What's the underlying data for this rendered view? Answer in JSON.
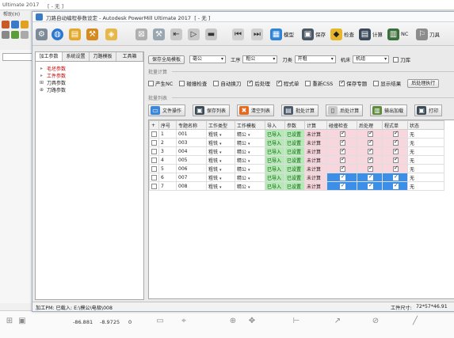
{
  "host": {
    "title": "Ultimate 2017",
    "title_tag": "[ - 无 ]",
    "menu_label": "帮助(H)",
    "status": {
      "coord_x": "-86.881",
      "coord_y": "-8.9725",
      "coord_z": "0",
      "icons": [
        "grid-snap-icon",
        "layer-icon",
        "plane-icon",
        "workplane-icon",
        "axis-icon",
        "view-icon",
        "measure-icon",
        "arrow-icon",
        "snap-icon"
      ]
    }
  },
  "window": {
    "title": "刀路自动编程参数设定 - Autodesk PowerMill Ultimate 2017",
    "title_suffix": "[ - 无 ]"
  },
  "toolbar": {
    "items": [
      {
        "icon": "gear-icon",
        "label": ""
      },
      {
        "icon": "globe-icon",
        "label": ""
      },
      {
        "icon": "toolpath-icon",
        "label": ""
      },
      {
        "icon": "machine-icon",
        "label": ""
      },
      {
        "icon": "block-icon",
        "label": ""
      },
      {
        "icon": "axis-icon",
        "label": ""
      },
      {
        "icon": "wrench-icon",
        "label": ""
      },
      {
        "icon": "arrow-left-icon",
        "label": ""
      },
      {
        "icon": "play-icon",
        "label": ""
      },
      {
        "icon": "panel-icon",
        "label": ""
      },
      {
        "icon": "first-icon",
        "label": ""
      },
      {
        "icon": "last-icon",
        "label": ""
      },
      {
        "icon": "model-icon",
        "label": "模型"
      },
      {
        "icon": "save-icon",
        "label": "保存"
      },
      {
        "icon": "warning-icon",
        "label": "检查"
      },
      {
        "icon": "calc-icon",
        "label": "计算"
      },
      {
        "icon": "nc-icon",
        "label": "NC"
      },
      {
        "icon": "tool-icon",
        "label": "刀具"
      }
    ]
  },
  "tree": {
    "tabs": [
      "加工参数",
      "系统设置",
      "刀路模板",
      "工具箱"
    ],
    "items": [
      {
        "icon": "triangle-icon",
        "label": "毛坯参数",
        "dark": false
      },
      {
        "icon": "triangle-icon",
        "label": "工件参数",
        "dark": false
      },
      {
        "icon": "tree-node-icon",
        "label": "刀具参数",
        "dark": true
      },
      {
        "icon": "tree-node-icon",
        "label": "刀路参数",
        "dark": true
      }
    ]
  },
  "options": {
    "template_button": "保存全局模板",
    "unit_value": "毫公",
    "process_label": "工序",
    "process_value": "粗公",
    "mode_label": "刀类",
    "mode_value": "开粗",
    "machine_label": "机床",
    "machine_value": "机组",
    "tool_checkbox": "刀库",
    "section_header": "批量计算",
    "checkboxes": [
      {
        "label": "产生NC",
        "checked": false
      },
      {
        "label": "碰撞检查",
        "checked": false
      },
      {
        "label": "自动换刀",
        "checked": false
      },
      {
        "label": "后处理",
        "checked": true
      },
      {
        "label": "程式单",
        "checked": true
      },
      {
        "label": "重新CSS",
        "checked": false
      },
      {
        "label": "保存专题",
        "checked": true
      },
      {
        "label": "显示结果",
        "checked": false
      }
    ],
    "run_button": "后处理执行",
    "list_header": "批量列表"
  },
  "actions": [
    {
      "icon": "file-icon",
      "label": "文件操作"
    },
    {
      "icon": "save-icon",
      "label": "保存列表"
    },
    {
      "icon": "delete-icon",
      "label": "清空列表"
    },
    {
      "icon": "calculator-icon",
      "label": "批处计算"
    },
    {
      "icon": "doc-icon",
      "label": "后处计算"
    },
    {
      "icon": "output-icon",
      "label": "输出加载"
    },
    {
      "icon": "print-icon",
      "label": "打印"
    }
  ],
  "grid": {
    "columns": [
      "序号",
      "专题名称",
      "工作类型",
      "工作模板",
      "导入",
      "参数",
      "计算",
      "碰撞检查",
      "后处理",
      "程式单",
      "状态"
    ],
    "rows": [
      {
        "no": "1",
        "name": "001",
        "type": "粗铣",
        "template": "精公",
        "import": "已导入",
        "param": "已设置",
        "calc": "未计算",
        "c1": true,
        "c2": true,
        "c3": true,
        "status": "无",
        "highlight": false
      },
      {
        "no": "2",
        "name": "003",
        "type": "粗铣",
        "template": "精公",
        "import": "已导入",
        "param": "已设置",
        "calc": "未计算",
        "c1": true,
        "c2": true,
        "c3": true,
        "status": "无",
        "highlight": false
      },
      {
        "no": "3",
        "name": "004",
        "type": "粗铣",
        "template": "精公",
        "import": "已导入",
        "param": "已设置",
        "calc": "未计算",
        "c1": true,
        "c2": true,
        "c3": true,
        "status": "无",
        "highlight": false
      },
      {
        "no": "4",
        "name": "005",
        "type": "粗铣",
        "template": "精公",
        "import": "已导入",
        "param": "已设置",
        "calc": "未计算",
        "c1": true,
        "c2": true,
        "c3": true,
        "status": "无",
        "highlight": false
      },
      {
        "no": "5",
        "name": "006",
        "type": "粗铣",
        "template": "精公",
        "import": "已导入",
        "param": "已设置",
        "calc": "未计算",
        "c1": true,
        "c2": true,
        "c3": true,
        "status": "无",
        "highlight": false
      },
      {
        "no": "6",
        "name": "007",
        "type": "粗铣",
        "template": "精公",
        "import": "已导入",
        "param": "已设置",
        "calc": "未计算",
        "c1": true,
        "c2": true,
        "c3": true,
        "status": "无",
        "highlight": true
      },
      {
        "no": "7",
        "name": "008",
        "type": "粗铣",
        "template": "精公",
        "import": "已导入",
        "param": "已设置",
        "calc": "未计算",
        "c1": true,
        "c2": true,
        "c3": true,
        "status": "无",
        "highlight": true
      }
    ]
  },
  "status": {
    "left": "加工PM: 已载入: E:\\模公\\电极\\008",
    "right": "工件尺寸:",
    "dims": "72*57*46.91"
  },
  "colors": {
    "accent": "#3d8ee6",
    "green_cell": "#b7e8b7",
    "pink_cell": "#f7d6dd",
    "tree_red": "#c00000"
  }
}
